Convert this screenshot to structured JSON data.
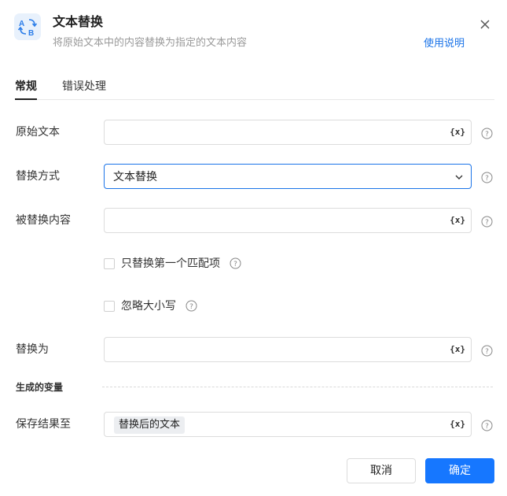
{
  "header": {
    "title": "文本替换",
    "subtitle": "将原始文本中的内容替换为指定的文本内容",
    "help_link": "使用说明",
    "icon": "text-replace-icon"
  },
  "tabs": [
    {
      "label": "常规",
      "active": true
    },
    {
      "label": "错误处理",
      "active": false
    }
  ],
  "form": {
    "original_text": {
      "label": "原始文本",
      "value": ""
    },
    "replace_mode": {
      "label": "替换方式",
      "value": "文本替换"
    },
    "replaced_content": {
      "label": "被替换内容",
      "value": ""
    },
    "only_first_match": {
      "label": "只替换第一个匹配项",
      "checked": false
    },
    "ignore_case": {
      "label": "忽略大小写",
      "checked": false
    },
    "replace_with": {
      "label": "替换为",
      "value": ""
    },
    "variable_button": "{x}"
  },
  "output": {
    "section_title": "生成的变量",
    "save_to": {
      "label": "保存结果至",
      "value": "替换后的文本"
    }
  },
  "footer": {
    "cancel": "取消",
    "confirm": "确定"
  },
  "colors": {
    "accent": "#1677ff",
    "link": "#1a73e8"
  }
}
